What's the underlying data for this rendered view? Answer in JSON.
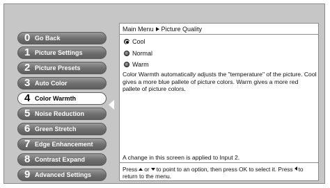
{
  "menu": {
    "items": [
      {
        "num": "0",
        "label": "Go Back"
      },
      {
        "num": "1",
        "label": "Picture Settings"
      },
      {
        "num": "2",
        "label": "Picture Presets"
      },
      {
        "num": "3",
        "label": "Auto Color"
      },
      {
        "num": "4",
        "label": "Color Warmth"
      },
      {
        "num": "5",
        "label": "Noise Reduction"
      },
      {
        "num": "6",
        "label": "Green Stretch"
      },
      {
        "num": "7",
        "label": "Edge Enhancement"
      },
      {
        "num": "8",
        "label": "Contrast Expand"
      },
      {
        "num": "9",
        "label": "Advanced Settings"
      }
    ],
    "selected_index": 4
  },
  "panel": {
    "breadcrumb": {
      "root": "Main Menu",
      "current": "Picture Quality"
    },
    "options": [
      {
        "label": "Cool",
        "selected": true
      },
      {
        "label": "Normal",
        "selected": false
      },
      {
        "label": "Warm",
        "selected": false
      }
    ],
    "description": "Color Warmth automatically adjusts the \"temperature\" of the picture. Cool gives a more blue pallete of picture colors. Warm gives a more red pallete of picture colors.",
    "note": "A change in this screen is applied to Input 2.",
    "footer": {
      "p1": "Press",
      "p2": "or",
      "p3": "to point to an option, then press OK to select it. Press",
      "p4": "to return to the menu."
    }
  }
}
